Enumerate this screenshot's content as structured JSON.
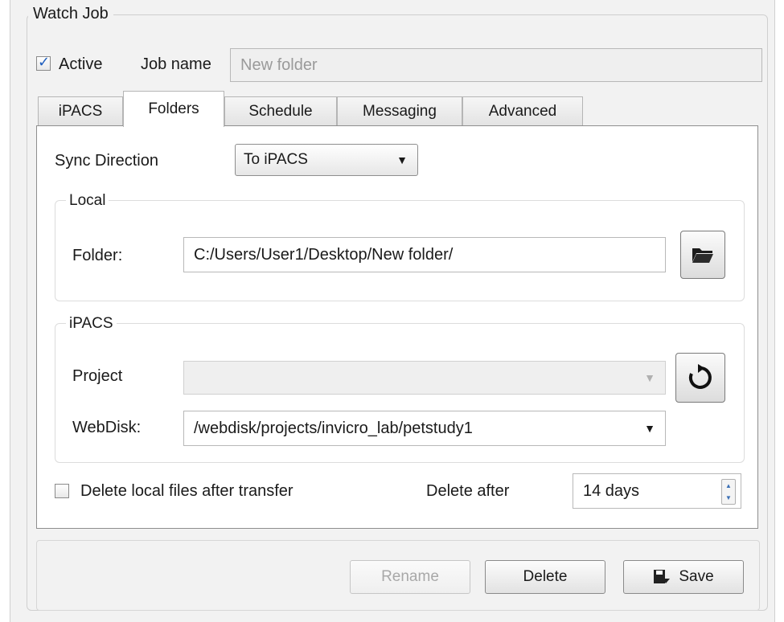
{
  "watch_job": {
    "title": "Watch Job",
    "active_label": "Active",
    "active_checked": true,
    "job_name_label": "Job name",
    "job_name_placeholder": "New folder"
  },
  "tabs": [
    {
      "label": "iPACS",
      "active": false
    },
    {
      "label": "Folders",
      "active": true
    },
    {
      "label": "Schedule",
      "active": false
    },
    {
      "label": "Messaging",
      "active": false
    },
    {
      "label": "Advanced",
      "active": false
    }
  ],
  "folders": {
    "sync_direction_label": "Sync Direction",
    "sync_direction_value": "To iPACS",
    "local": {
      "title": "Local",
      "folder_label": "Folder:",
      "folder_value": "C:/Users/User1/Desktop/New folder/",
      "browse_icon": "folder-open-icon"
    },
    "ipacs": {
      "title": "iPACS",
      "project_label": "Project",
      "project_value": "",
      "refresh_icon": "refresh-icon",
      "webdisk_label": "WebDisk:",
      "webdisk_value": "/webdisk/projects/invicro_lab/petstudy1"
    },
    "delete_local_label": "Delete local files after transfer",
    "delete_local_checked": false,
    "delete_after_label": "Delete after",
    "delete_after_value": "14 days"
  },
  "buttons": {
    "rename": "Rename",
    "delete": "Delete",
    "save": "Save"
  },
  "colors": {
    "check_blue": "#1f5fbf",
    "panel_bg": "#f2f2f2"
  }
}
